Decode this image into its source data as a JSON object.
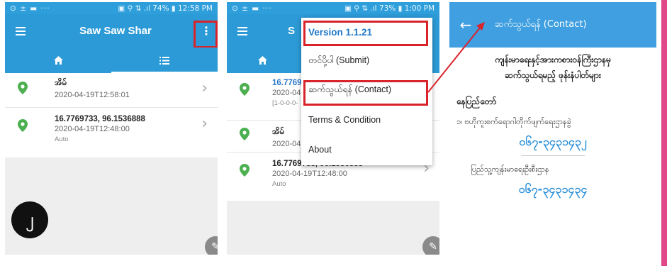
{
  "screen1": {
    "status_left": "⊙ ± ▬ ···",
    "status_right": "▣ ⚲ ⇅ .ıl 74% ▮ 12:58 PM",
    "app_title": "Saw Saw Shar",
    "rows": [
      {
        "title": "အိမ်",
        "time": "2020-04-19T12:58:01",
        "note": ""
      },
      {
        "title": "16.7769733, 96.1536888",
        "time": "2020-04-19T12:48:00",
        "note": "Auto"
      }
    ],
    "badge": "၂"
  },
  "screen2": {
    "status_left": "⊙ ± ▬ ···",
    "status_right": "▣ ⚲ ⇅ .ıl 73% ▮ 1:00 PM",
    "app_title_partial": "S",
    "menu": {
      "version": "Version 1.1.21",
      "submit": "တင်ပို့ပါ (Submit)",
      "contact": "ဆက်သွယ်ရန် (Contact)",
      "terms": "Terms & Condition",
      "about": "About"
    },
    "rows": [
      {
        "title": "16.7769",
        "time": "2020-04",
        "note": "[1-0-0-0-"
      },
      {
        "title": "အိမ်",
        "time": "2020-04-19T12:58:01",
        "note": ""
      },
      {
        "title": "16.7769733, 96.1536888",
        "time": "2020-04-19T12:48:00",
        "note": "Auto"
      }
    ]
  },
  "screen3": {
    "title": "ဆက်သွယ်ရန် (Contact)",
    "heading_line1": "ကျန်းမာရေးနှင့်အားကစားဝန်ကြီးဌာနမှ",
    "heading_line2": "ဆက်သွယ်ရမည့် ဖုန်းနံပါတ်များ",
    "city": "နေပြည်တော်",
    "dept1": "၁၊ ဗဟိုကူးစက်ရောဂါတိုက်ဖျက်ရေးဌာနခွဲ",
    "phone1": "၀၆၇-၃၄၃၁၄၃၂",
    "dept2": "ပြည်သူ့ကျန်းမာရေးဦးစီးဌာန",
    "phone2": "၀၆၇-၃၄၃၁၄၃၄"
  },
  "colors": {
    "appbar": "#2c9ad6",
    "highlight": "#d9232a",
    "pin": "#4caf50",
    "accent_edge": "#e0488a"
  },
  "icons": [
    "menu-icon",
    "home-icon",
    "list-icon",
    "more-vert-icon",
    "location-pin-icon",
    "chevron-right-icon",
    "edit-icon",
    "back-arrow-icon"
  ]
}
